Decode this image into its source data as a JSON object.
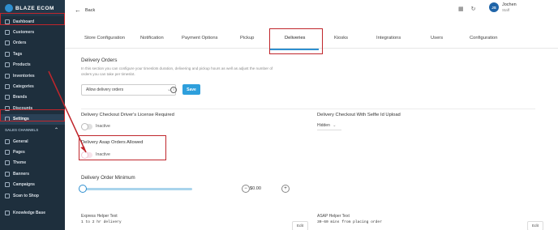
{
  "sidebar": {
    "brand": "BLAZE ECOM",
    "items": [
      {
        "label": "Dashboard"
      },
      {
        "label": "Customers"
      },
      {
        "label": "Orders"
      },
      {
        "label": "Tags"
      },
      {
        "label": "Products"
      },
      {
        "label": "Inventories"
      },
      {
        "label": "Categories"
      },
      {
        "label": "Brands"
      },
      {
        "label": "Discounts"
      },
      {
        "label": "Settings"
      }
    ],
    "sales_channels_label": "SALES CHANNELS",
    "channel_items": [
      {
        "label": "General"
      },
      {
        "label": "Pages"
      },
      {
        "label": "Theme"
      },
      {
        "label": "Banners"
      },
      {
        "label": "Campaigns"
      },
      {
        "label": "Scan to Shop"
      }
    ],
    "knowledge_base": "Knowledge Base"
  },
  "topbar": {
    "back_label": "Back",
    "user_initials": "JS",
    "user_name": "Jochen",
    "user_role": "Staff"
  },
  "tabs": [
    {
      "label": "Store Configuration"
    },
    {
      "label": "Notification"
    },
    {
      "label": "Payment Options"
    },
    {
      "label": "Pickup"
    },
    {
      "label": "Deliveries"
    },
    {
      "label": "Kiosks"
    },
    {
      "label": "Integrations"
    },
    {
      "label": "Users"
    },
    {
      "label": "Configuration"
    }
  ],
  "delivery_orders": {
    "title": "Delivery Orders",
    "description_line1": "In this section you can configure your timeslots duration, delivering and pickup hours as well as adjust the number of",
    "description_line2": "orders you can take per timeslot.",
    "select_value": "Allow delivery orders",
    "save_label": "Save"
  },
  "license": {
    "title": "Delivery Checkout Driver's License Required",
    "status": "Inactive"
  },
  "selfie": {
    "title": "Delivery Checkout With Selfie Id Upload",
    "value": "Hidden"
  },
  "asap": {
    "title": "Delivery Asap Orders Allowed",
    "status": "Inactive"
  },
  "minimum": {
    "title": "Delivery Order Minimum",
    "value": "$0.00",
    "minus": "−",
    "plus": "+",
    "slider_level": 0
  },
  "express": {
    "title": "Express Helper Text",
    "text": "1 to 2 hr delivery",
    "edit_label": "Edit"
  },
  "asap_helper": {
    "title": "ASAP Helper Text",
    "text": "30-60 mins from placing order",
    "edit_label": "Edit"
  },
  "colors": {
    "accent": "#2e8fd0",
    "annotation": "#c0262c",
    "sidebar": "#1e2f3d"
  }
}
